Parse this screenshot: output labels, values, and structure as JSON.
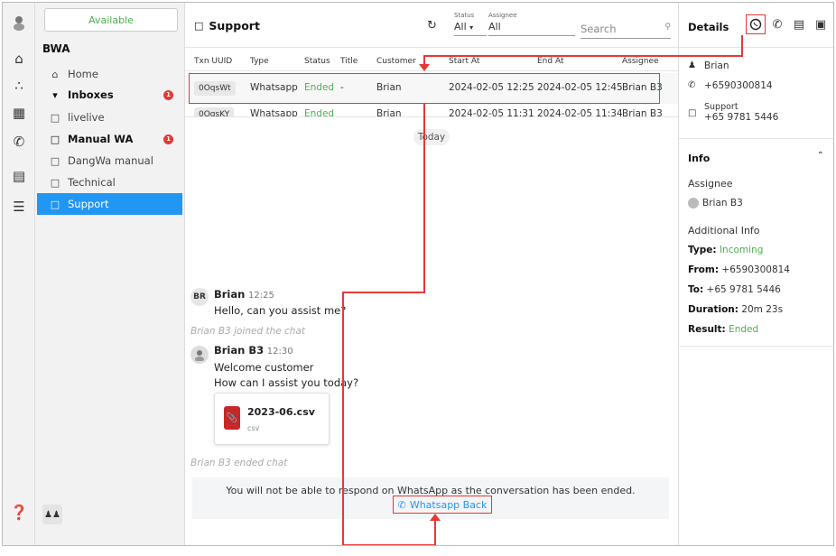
{
  "nav": {
    "status": "Available",
    "org": "BWA",
    "items": [
      {
        "label": "Home"
      },
      {
        "label": "Inboxes",
        "badge": "1"
      },
      {
        "label": "livelive"
      },
      {
        "label": "Manual WA",
        "badge": "1"
      },
      {
        "label": "DangWa manual"
      },
      {
        "label": "Technical"
      },
      {
        "label": "Support"
      }
    ]
  },
  "header": {
    "title": "Support",
    "status_label": "Status",
    "status_value": "All",
    "assignee_label": "Assignee",
    "assignee_value": "All",
    "search_placeholder": "Search"
  },
  "table": {
    "columns": [
      "Txn UUID",
      "Type",
      "Status",
      "Title",
      "Customer",
      "Start At",
      "End At",
      "Assignee"
    ],
    "rows": [
      {
        "uuid": "0OqsWt",
        "type": "Whatsapp",
        "status": "Ended",
        "title": "-",
        "customer": "Brian",
        "start": "2024-02-05 12:25",
        "end": "2024-02-05 12:45",
        "assignee": "Brian B3"
      },
      {
        "uuid": "0OqsKY",
        "type": "Whatsapp",
        "status": "Ended",
        "title": "-",
        "customer": "Brian",
        "start": "2024-02-05 11:31",
        "end": "2024-02-05 11:34",
        "assignee": "Brian B3"
      }
    ]
  },
  "chat": {
    "today": "Today",
    "m1_name": "Brian",
    "m1_initials": "BR",
    "m1_time": "12:25",
    "m1_text": "Hello, can you assist me?",
    "joined": "Brian B3 joined the chat",
    "m2_name": "Brian B3",
    "m2_time": "12:30",
    "m2_line1": "Welcome customer",
    "m2_line2": "How can I assist you today?",
    "file_name": "2023-06.csv",
    "file_type": "csv",
    "ended": "Brian B3 ended chat",
    "notice": "You will not be able to respond on WhatsApp as the conversation has been ended.",
    "back_button": "Whatsapp Back"
  },
  "details": {
    "title": "Details",
    "customer_name": "Brian",
    "phone": "+6590300814",
    "inbox": "Support",
    "inbox_phone": "+65 9781 5446",
    "info_title": "Info",
    "assignee_label": "Assignee",
    "assignee": "Brian B3",
    "additional": "Additional Info",
    "type_label": "Type:",
    "type_value": "Incoming",
    "from_label": "From:",
    "from_value": "+6590300814",
    "to_label": "To:",
    "to_value": "+65 9781 5446",
    "duration_label": "Duration:",
    "duration_value": "20m 23s",
    "result_label": "Result:",
    "result_value": "Ended"
  },
  "colors": {
    "accent": "#2196f3",
    "green": "#4caf50",
    "annotation": "#e53935"
  }
}
